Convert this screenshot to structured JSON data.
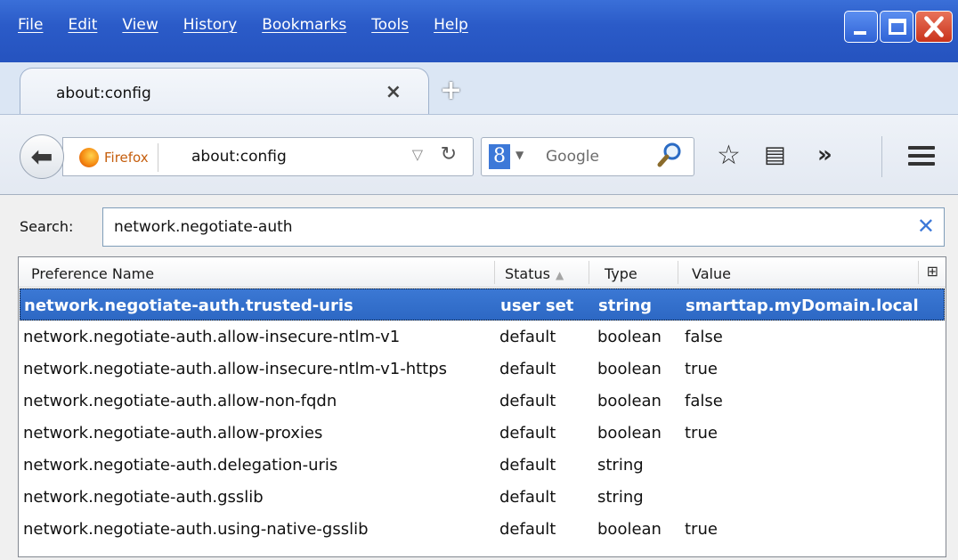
{
  "menu": [
    "File",
    "Edit",
    "View",
    "History",
    "Bookmarks",
    "Tools",
    "Help"
  ],
  "tab": {
    "title": "about:config"
  },
  "nav": {
    "identity_label": "Firefox",
    "url": "about:config",
    "search_placeholder": "Google",
    "search_engine_glyph": "8"
  },
  "config": {
    "search_label": "Search:",
    "search_value": "network.negotiate-auth",
    "columns": {
      "name": "Preference Name",
      "status": "Status",
      "type": "Type",
      "value": "Value"
    },
    "rows": [
      {
        "name": "network.negotiate-auth.trusted-uris",
        "status": "user set",
        "type": "string",
        "value": "smarttap.myDomain.local",
        "selected": true
      },
      {
        "name": "network.negotiate-auth.allow-insecure-ntlm-v1",
        "status": "default",
        "type": "boolean",
        "value": "false"
      },
      {
        "name": "network.negotiate-auth.allow-insecure-ntlm-v1-https",
        "status": "default",
        "type": "boolean",
        "value": "true"
      },
      {
        "name": "network.negotiate-auth.allow-non-fqdn",
        "status": "default",
        "type": "boolean",
        "value": "false"
      },
      {
        "name": "network.negotiate-auth.allow-proxies",
        "status": "default",
        "type": "boolean",
        "value": "true"
      },
      {
        "name": "network.negotiate-auth.delegation-uris",
        "status": "default",
        "type": "string",
        "value": ""
      },
      {
        "name": "network.negotiate-auth.gsslib",
        "status": "default",
        "type": "string",
        "value": ""
      },
      {
        "name": "network.negotiate-auth.using-native-gsslib",
        "status": "default",
        "type": "boolean",
        "value": "true"
      }
    ]
  },
  "colors": {
    "selection": "#3b78d4",
    "titlebar": "#2b5bc8",
    "accent": "#3c78d8"
  }
}
